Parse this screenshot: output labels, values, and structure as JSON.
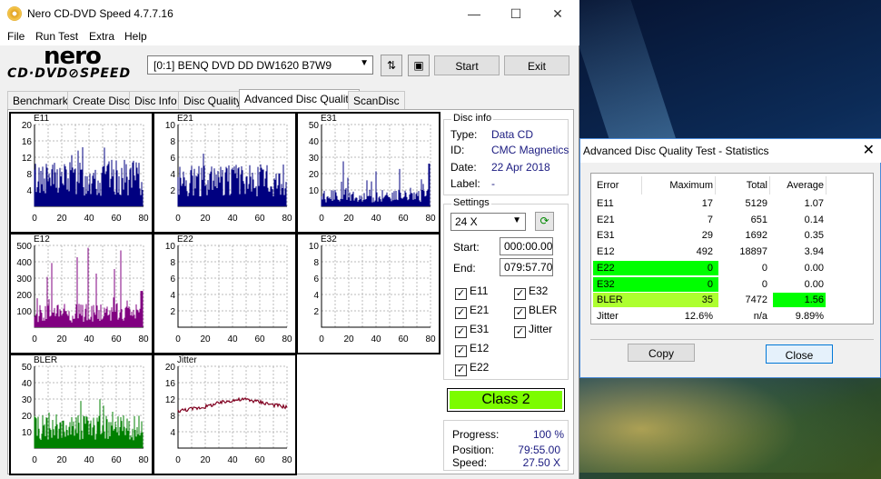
{
  "window": {
    "title": "Nero CD-DVD Speed 4.7.7.16",
    "minimize": "—",
    "maximize": "☐",
    "close": "✕"
  },
  "menu": [
    "File",
    "Run Test",
    "Extra",
    "Help"
  ],
  "logo": {
    "line1": "nero",
    "line2": "CD·DVD⊘SPEED"
  },
  "toolbar": {
    "drive": "[0:1]   BENQ DVD DD DW1620 B7W9",
    "start": "Start",
    "exit": "Exit",
    "swap_icon": "eject-icon",
    "save_icon": "save-icon"
  },
  "tabs": [
    "Benchmark",
    "Create Disc",
    "Disc Info",
    "Disc Quality",
    "Advanced Disc Quality",
    "ScanDisc"
  ],
  "active_tab": "Advanced Disc Quality",
  "disc_info": {
    "caption": "Disc info",
    "type_label": "Type:",
    "type": "Data CD",
    "id_label": "ID:",
    "id": "CMC Magnetics",
    "date_label": "Date:",
    "date": "22 Apr 2018",
    "label_label": "Label:",
    "label": "-"
  },
  "settings": {
    "caption": "Settings",
    "speed": "24 X",
    "start_label": "Start:",
    "start": "000:00.00",
    "end_label": "End:",
    "end": "079:57.70",
    "checks": [
      {
        "label": "E11",
        "checked": true
      },
      {
        "label": "E32",
        "checked": true
      },
      {
        "label": "E21",
        "checked": true
      },
      {
        "label": "BLER",
        "checked": true
      },
      {
        "label": "E31",
        "checked": true
      },
      {
        "label": "Jitter",
        "checked": true
      },
      {
        "label": "E12",
        "checked": true
      },
      {
        "label": "E22",
        "checked": true
      }
    ]
  },
  "class": "Class 2",
  "progress": {
    "progress_label": "Progress:",
    "progress": "100 %",
    "position_label": "Position:",
    "position": "79:55.00",
    "speed_label": "Speed:",
    "speed": "27.50 X"
  },
  "chart_data": [
    {
      "name": "E11",
      "type": "bar",
      "color": "#000080",
      "x_ticks": [
        "0",
        "20",
        "40",
        "60",
        "80"
      ],
      "y_ticks": [
        "20",
        "16",
        "12",
        "8",
        "4"
      ],
      "ylim": [
        0,
        20
      ],
      "xlim": [
        0,
        80
      ]
    },
    {
      "name": "E21",
      "type": "bar",
      "color": "#000080",
      "x_ticks": [
        "0",
        "20",
        "40",
        "60",
        "80"
      ],
      "y_ticks": [
        "10",
        "8",
        "6",
        "4",
        "2"
      ],
      "ylim": [
        0,
        10
      ],
      "xlim": [
        0,
        80
      ]
    },
    {
      "name": "E31",
      "type": "bar",
      "color": "#000080",
      "x_ticks": [
        "0",
        "20",
        "40",
        "60",
        "80"
      ],
      "y_ticks": [
        "50",
        "40",
        "30",
        "20",
        "10"
      ],
      "ylim": [
        0,
        50
      ],
      "xlim": [
        0,
        80
      ]
    },
    {
      "name": "E12",
      "type": "bar",
      "color": "#800080",
      "x_ticks": [
        "0",
        "20",
        "40",
        "60",
        "80"
      ],
      "y_ticks": [
        "500",
        "400",
        "300",
        "200",
        "100"
      ],
      "ylim": [
        0,
        500
      ],
      "xlim": [
        0,
        80
      ]
    },
    {
      "name": "E22",
      "type": "bar",
      "color": "#800080",
      "x_ticks": [
        "0",
        "20",
        "40",
        "60",
        "80"
      ],
      "y_ticks": [
        "10",
        "8",
        "6",
        "4",
        "2"
      ],
      "ylim": [
        0,
        10
      ],
      "xlim": [
        0,
        80
      ]
    },
    {
      "name": "E32",
      "type": "bar",
      "color": "#800080",
      "x_ticks": [
        "0",
        "20",
        "40",
        "60",
        "80"
      ],
      "y_ticks": [
        "10",
        "8",
        "6",
        "4",
        "2"
      ],
      "ylim": [
        0,
        10
      ],
      "xlim": [
        0,
        80
      ]
    },
    {
      "name": "BLER",
      "type": "bar",
      "color": "#008000",
      "x_ticks": [
        "0",
        "20",
        "40",
        "60",
        "80"
      ],
      "y_ticks": [
        "50",
        "40",
        "30",
        "20",
        "10"
      ],
      "ylim": [
        0,
        50
      ],
      "xlim": [
        0,
        80
      ]
    },
    {
      "name": "Jitter",
      "type": "line",
      "color": "#800020",
      "x_ticks": [
        "0",
        "20",
        "40",
        "60",
        "80"
      ],
      "y_ticks": [
        "20",
        "16",
        "12",
        "8",
        "4"
      ],
      "ylim": [
        0,
        20
      ],
      "xlim": [
        0,
        80
      ],
      "x": [
        0,
        10,
        20,
        30,
        40,
        50,
        60,
        70,
        80
      ],
      "y": [
        9.1,
        9.6,
        10.1,
        11.0,
        11.7,
        11.9,
        11.3,
        10.6,
        10.0
      ]
    }
  ],
  "stats": {
    "title": "Advanced Disc Quality Test - Statistics",
    "close": "✕",
    "headers": [
      "Error",
      "Maximum",
      "Total",
      "Average"
    ],
    "rows": [
      {
        "error": "E11",
        "max": "17",
        "total": "5129",
        "avg": "1.07"
      },
      {
        "error": "E21",
        "max": "7",
        "total": "651",
        "avg": "0.14"
      },
      {
        "error": "E31",
        "max": "29",
        "total": "1692",
        "avg": "0.35"
      },
      {
        "error": "E12",
        "max": "492",
        "total": "18897",
        "avg": "3.94"
      },
      {
        "error": "E22",
        "max": "0",
        "total": "0",
        "avg": "0.00"
      },
      {
        "error": "E32",
        "max": "0",
        "total": "0",
        "avg": "0.00"
      },
      {
        "error": "BLER",
        "max": "35",
        "total": "7472",
        "avg": "1.56"
      },
      {
        "error": "Jitter",
        "max": "12.6%",
        "total": "n/a",
        "avg": "9.89%"
      }
    ],
    "copy": "Copy",
    "close_btn": "Close",
    "highlight_green": "#00ff00",
    "highlight_yellow": "#adff2f"
  }
}
